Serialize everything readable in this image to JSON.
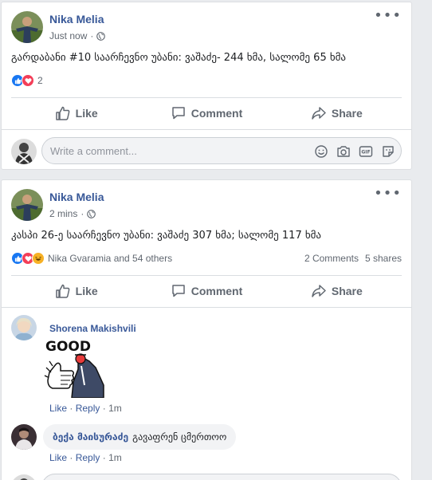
{
  "posts": [
    {
      "author": "Nika Melia",
      "time": "Just now",
      "text": "გარდაბანი #10 საარჩევნო უბანი: ვაშაძე- 244 ხმა, სალომე 65 ხმა",
      "reactions": {
        "count": "2",
        "types": [
          "like-icon",
          "love-icon"
        ]
      },
      "actions": {
        "like": "Like",
        "comment": "Comment",
        "share": "Share"
      },
      "comment_placeholder": "Write a comment..."
    },
    {
      "author": "Nika Melia",
      "time": "2 mins",
      "text": "კასპი 26-ე საარჩევნო უბანი: ვაშაძე 307 ხმა; სალომე 117 ხმა",
      "reactions": {
        "summary": "Nika Gvaramia and 54 others",
        "types": [
          "like-icon",
          "love-icon",
          "haha-icon"
        ]
      },
      "comments_count": "2 Comments",
      "shares_count": "5 shares",
      "actions": {
        "like": "Like",
        "comment": "Comment",
        "share": "Share"
      },
      "comments": [
        {
          "author": "Shorena Makishvili",
          "sticker_text": "GOOD",
          "like": "Like",
          "reply": "Reply",
          "time": "1m"
        },
        {
          "author": "ბექა მაისურაძე",
          "text": "გავაფრენ ცმერთოო",
          "like": "Like",
          "reply": "Reply",
          "time": "1m"
        }
      ]
    }
  ],
  "colors": {
    "link": "#385898",
    "like_blue": "#1877f2",
    "love_red": "#f33e58",
    "haha_yellow": "#f7b125",
    "muted": "#606770"
  }
}
